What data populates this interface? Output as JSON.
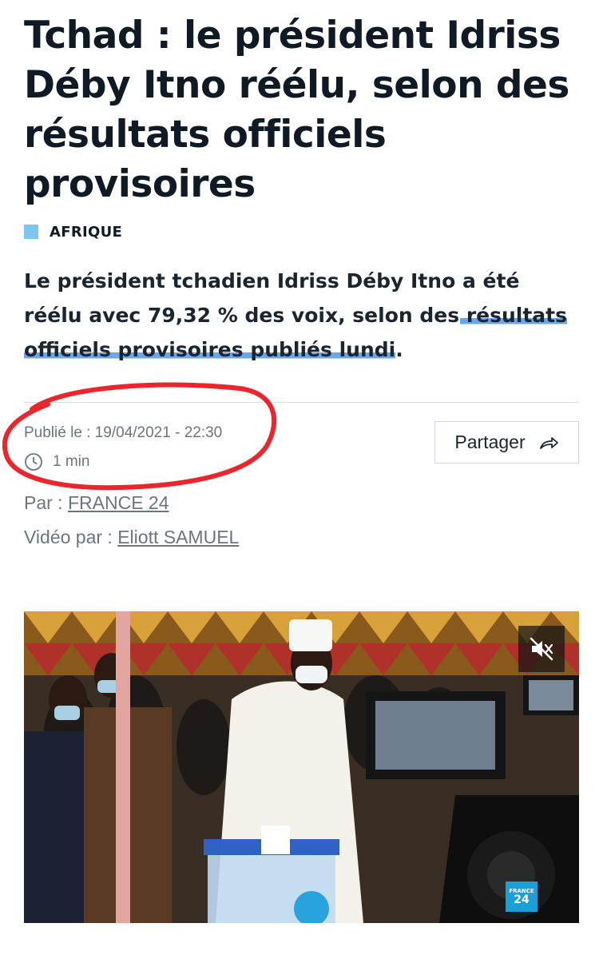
{
  "article": {
    "headline": "Tchad : le président Idriss Déby Itno réélu, selon des résultats officiels provisoires",
    "category": "AFRIQUE",
    "lead_part1": "Le président tchadien Idriss Déby Itno a été réélu avec 79,32 % des voix, selon des ",
    "lead_highlight": "résultats officiels provisoires publiés lundi",
    "lead_end": ".",
    "published": "Publié le : 19/04/2021 - 22:30",
    "read_time": "1 min",
    "share_label": "Partager",
    "by_label": "Par : ",
    "by_value": "FRANCE 24",
    "video_by_label": "Vidéo par : ",
    "video_by_value": "Eliott SAMUEL"
  },
  "video": {
    "mute_icon": "speaker-muted-icon",
    "logo_line1": "FRANCE",
    "logo_line2": "24"
  },
  "colors": {
    "category_square": "#7cc6f0",
    "highlight": "#6aa7e8",
    "annotation_circle": "#e8262c"
  }
}
